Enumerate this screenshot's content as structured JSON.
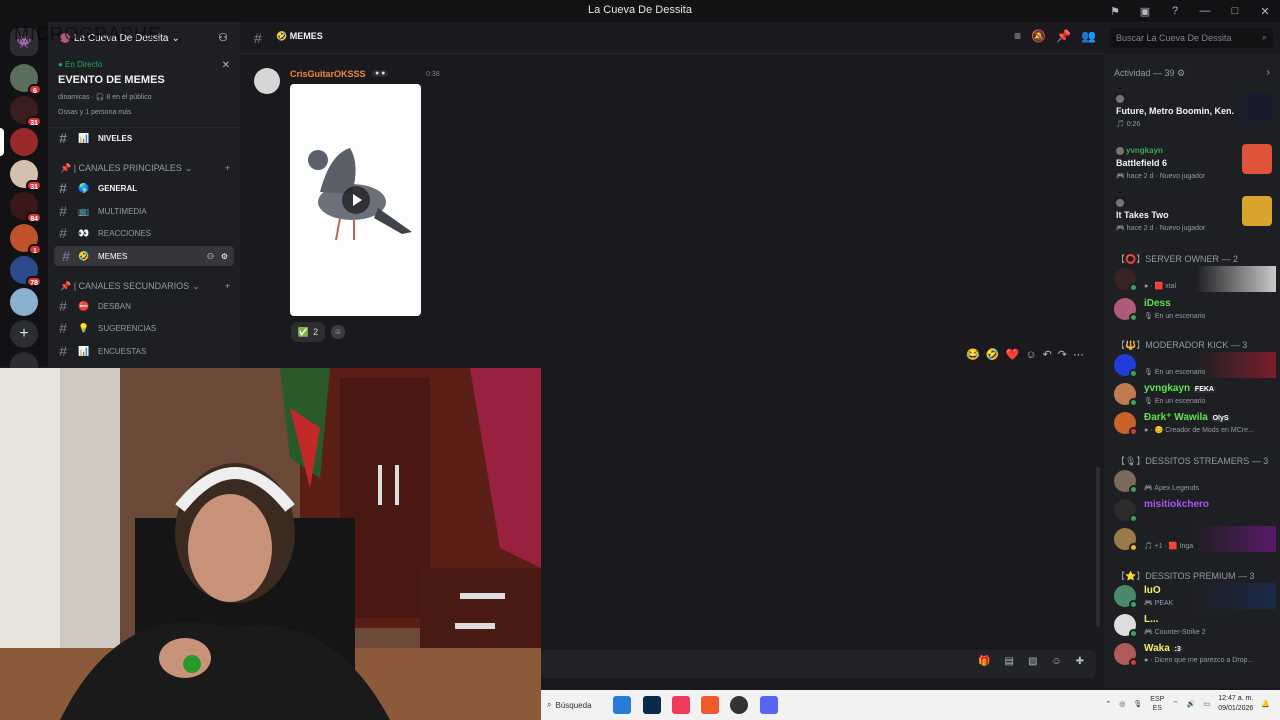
{
  "window": {
    "title": "La Cueva De Dessita",
    "minimize": "—",
    "maximize": "□",
    "close": "✕"
  },
  "overlay_text": "MICROGRAPHE",
  "guild_badges": [
    "6",
    "31",
    "31",
    "84",
    "1",
    "78"
  ],
  "sidebar": {
    "server_name": "La Cueva De Dessita",
    "event": {
      "live_label": "● En Directo",
      "title": "EVENTO DE MEMES",
      "meta": "dinamicas · 🎧 8 en el público",
      "attendees": "Ossas y 1 persona más"
    },
    "channels_top": [
      {
        "name": "NIVELES",
        "emoji": "📊"
      }
    ],
    "categories": [
      {
        "label": "📌 | CANALES PRINCIPALES",
        "channels": [
          {
            "name": "GENERAL",
            "emoji": "🌎",
            "bold": true
          },
          {
            "name": "MULTIMEDIA",
            "emoji": "📺"
          },
          {
            "name": "REACCIONES",
            "emoji": "👀"
          },
          {
            "name": "MEMES",
            "emoji": "🤣",
            "active": true
          }
        ]
      },
      {
        "label": "📌 | CANALES SECUNDARIOS",
        "channels": [
          {
            "name": "DESBAN",
            "emoji": "⛔"
          },
          {
            "name": "SUGERENCIAS",
            "emoji": "💡"
          },
          {
            "name": "ENCUESTAS",
            "emoji": "📊"
          }
        ]
      }
    ]
  },
  "chat": {
    "channel_name": "MEMES",
    "channel_emoji": "🤣",
    "message": {
      "username": "CrisGuitarOKSSS",
      "tag": "● ●",
      "time": "0:38",
      "reaction_emoji": "✅",
      "reaction_count": "2"
    },
    "hover_reactions": [
      "😂",
      "🤣",
      "❤️"
    ]
  },
  "search": {
    "placeholder": "Buscar La Cueva De Dessita"
  },
  "members": {
    "activity_header": "Actividad — 39 ⚙",
    "activities": [
      {
        "user": "",
        "game": "Future, Metro Boomin, Ken...",
        "sub": "🎵 0:26",
        "user_color": "#a855f7",
        "thumb": "#1b1b2e"
      },
      {
        "user": "yvngkayn",
        "game": "Battlefield 6",
        "sub": "🎮 hace 2 d · Nuevo jugador",
        "user_color": "#3ba55d",
        "thumb": "#e0523a"
      },
      {
        "user": "",
        "game": "It Takes Two",
        "sub": "🎮 hace 2 d · Nuevo jugador",
        "user_color": "#a855f7",
        "thumb": "#d9a32c"
      }
    ],
    "roles": [
      {
        "header": "【⭕】SERVER OWNER — 2",
        "members": [
          {
            "name": "",
            "status": "● · 🟥 xtal",
            "color": "#da373c",
            "av": "#3a2323",
            "dot": "#3ba55d",
            "banner": "#c9c9c9"
          },
          {
            "name": "iDess",
            "status": "🎙 En un escenario",
            "color": "#5ee34f",
            "av": "#b05a7a",
            "dot": "#3ba55d"
          }
        ]
      },
      {
        "header": "【🔱】MODERADOR KICK — 3",
        "members": [
          {
            "name": "",
            "status": "🎙 En un escenario",
            "color": "#3b82f6",
            "av": "#1f3ddb",
            "dot": "#3ba55d",
            "banner": "#7a1f2a"
          },
          {
            "name": "yvngkayn",
            "status": "🎙 En un escenario",
            "color": "#5ee34f",
            "av": "#c27a50",
            "dot": "#3ba55d",
            "tag": "FEKA"
          },
          {
            "name": "Ðark⁺ Wawila",
            "status": "● · 😊 Creador de Mods en MCre...",
            "color": "#5ee34f",
            "av": "#c9632a",
            "dot": "#da373c",
            "tag": "OlyS"
          }
        ]
      },
      {
        "header": "【🎙】DESSITOS STREAMERS — 3",
        "members": [
          {
            "name": "",
            "status": "🎮 Apex Legends",
            "color": "#a855f7",
            "av": "#7a6a5a",
            "dot": "#3ba55d"
          },
          {
            "name": "misitiokchero",
            "status": "",
            "color": "#a855f7",
            "av": "#2c2c2c",
            "dot": "#3ba55d"
          },
          {
            "name": "",
            "status": "🎵 +1 · 🟥 Inga",
            "color": "#a855f7",
            "av": "#9a7a4a",
            "dot": "#f0b232",
            "banner": "#5a1a6a"
          }
        ]
      },
      {
        "header": "【⭐】DESSITOS PREMIUM — 3",
        "members": [
          {
            "name": "luO",
            "status": "🎮 PEAK",
            "color": "#f3f35f",
            "av": "#4a8a6a",
            "dot": "#3ba55d",
            "banner": "#1a2a4a"
          },
          {
            "name": "L...",
            "status": "🎮 Counter-Strike 2",
            "color": "#f3f35f",
            "av": "#dddddd",
            "dot": "#3ba55d"
          },
          {
            "name": "Waka",
            "status": "● · Dicen que me parezco a Drop...",
            "color": "#f3f35f",
            "av": "#b05a5a",
            "dot": "#da373c",
            "tag": ":3"
          }
        ]
      }
    ]
  },
  "taskbar": {
    "search_label": "Búsqueda",
    "lang": "ESP",
    "lang2": "ES",
    "time": "12:47 a. m.",
    "date": "09/01/2026"
  }
}
